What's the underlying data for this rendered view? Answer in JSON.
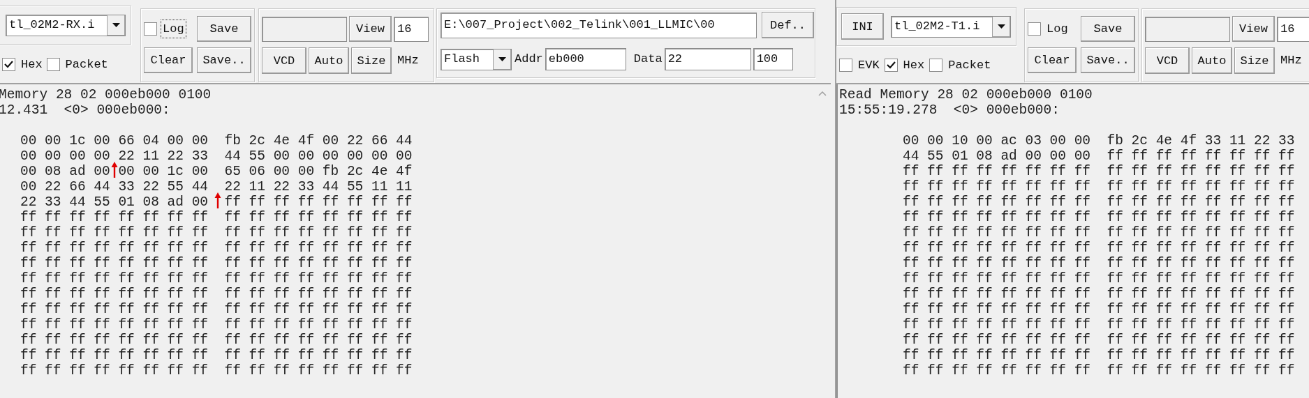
{
  "left_window": {
    "toolbar": {
      "file_combo": {
        "value": "tl_02M2-RX.i"
      },
      "checkboxes": [
        {
          "label": "Hex",
          "checked": true
        },
        {
          "label": "Packet",
          "checked": false
        }
      ],
      "log_checkbox": {
        "label": "Log",
        "checked": false,
        "focused": true
      },
      "log_buttons": [
        "Save",
        "Clear",
        "Save.."
      ],
      "view_group": {
        "view_button": "View",
        "view_value": "16",
        "buttons": [
          "VCD",
          "Auto",
          "Size"
        ],
        "unit": "MHz"
      },
      "path_field": {
        "value": "E:\\007_Project\\002_Telink\\001_LLMIC\\00"
      },
      "def_button": "Def..",
      "memory_combo": {
        "value": "Flash"
      },
      "addr_label": "Addr",
      "addr_value": "eb000",
      "data_label": "Data",
      "data_value": "22",
      "count_value": "100"
    },
    "log": {
      "header_lines": [
        "Memory 28 02 000eb000 0100",
        "12.431  <0> 000eb000:"
      ],
      "hex_rows": [
        "00 00 1c 00 66 04 00 00  fb 2c 4e 4f 00 22 66 44",
        "00 00 00 00 22 11 22 33  44 55 00 00 00 00 00 00",
        "00 08 ad 00 00 00 1c 00  65 06 00 00 fb 2c 4e 4f",
        "00 22 66 44 33 22 55 44  22 11 22 33 44 55 11 11",
        "22 33 44 55 01 08 ad 00  ff ff ff ff ff ff ff ff",
        "ff ff ff ff ff ff ff ff  ff ff ff ff ff ff ff ff",
        "ff ff ff ff ff ff ff ff  ff ff ff ff ff ff ff ff",
        "ff ff ff ff ff ff ff ff  ff ff ff ff ff ff ff ff",
        "ff ff ff ff ff ff ff ff  ff ff ff ff ff ff ff ff",
        "ff ff ff ff ff ff ff ff  ff ff ff ff ff ff ff ff",
        "ff ff ff ff ff ff ff ff  ff ff ff ff ff ff ff ff",
        "ff ff ff ff ff ff ff ff  ff ff ff ff ff ff ff ff",
        "ff ff ff ff ff ff ff ff  ff ff ff ff ff ff ff ff",
        "ff ff ff ff ff ff ff ff  ff ff ff ff ff ff ff ff",
        "ff ff ff ff ff ff ff ff  ff ff ff ff ff ff ff ff",
        "ff ff ff ff ff ff ff ff  ff ff ff ff ff ff ff ff"
      ]
    }
  },
  "right_window": {
    "toolbar": {
      "ini_button": "INI",
      "file_combo": {
        "value": "tl_02M2-T1.i"
      },
      "checkboxes": [
        {
          "label": "EVK",
          "checked": false
        },
        {
          "label": "Hex",
          "checked": true
        },
        {
          "label": "Packet",
          "checked": false
        }
      ],
      "log_checkbox": {
        "label": "Log",
        "checked": false,
        "focused": false
      },
      "log_buttons": [
        "Save",
        "Clear",
        "Save.."
      ],
      "view_group": {
        "view_button": "View",
        "view_value": "16",
        "buttons": [
          "VCD",
          "Auto",
          "Size"
        ],
        "unit": "MHz"
      }
    },
    "log": {
      "header_lines": [
        "Read Memory 28 02 000eb000 0100",
        "15:55:19.278  <0> 000eb000:"
      ],
      "hex_rows": [
        "00 00 10 00 ac 03 00 00  fb 2c 4e 4f 33 11 22 33",
        "44 55 01 08 ad 00 00 00  ff ff ff ff ff ff ff ff",
        "ff ff ff ff ff ff ff ff  ff ff ff ff ff ff ff ff",
        "ff ff ff ff ff ff ff ff  ff ff ff ff ff ff ff ff",
        "ff ff ff ff ff ff ff ff  ff ff ff ff ff ff ff ff",
        "ff ff ff ff ff ff ff ff  ff ff ff ff ff ff ff ff",
        "ff ff ff ff ff ff ff ff  ff ff ff ff ff ff ff ff",
        "ff ff ff ff ff ff ff ff  ff ff ff ff ff ff ff ff",
        "ff ff ff ff ff ff ff ff  ff ff ff ff ff ff ff ff",
        "ff ff ff ff ff ff ff ff  ff ff ff ff ff ff ff ff",
        "ff ff ff ff ff ff ff ff  ff ff ff ff ff ff ff ff",
        "ff ff ff ff ff ff ff ff  ff ff ff ff ff ff ff ff",
        "ff ff ff ff ff ff ff ff  ff ff ff ff ff ff ff ff",
        "ff ff ff ff ff ff ff ff  ff ff ff ff ff ff ff ff",
        "ff ff ff ff ff ff ff ff  ff ff ff ff ff ff ff ff",
        "ff ff ff ff ff ff ff ff  ff ff ff ff ff ff ff ff"
      ]
    }
  }
}
